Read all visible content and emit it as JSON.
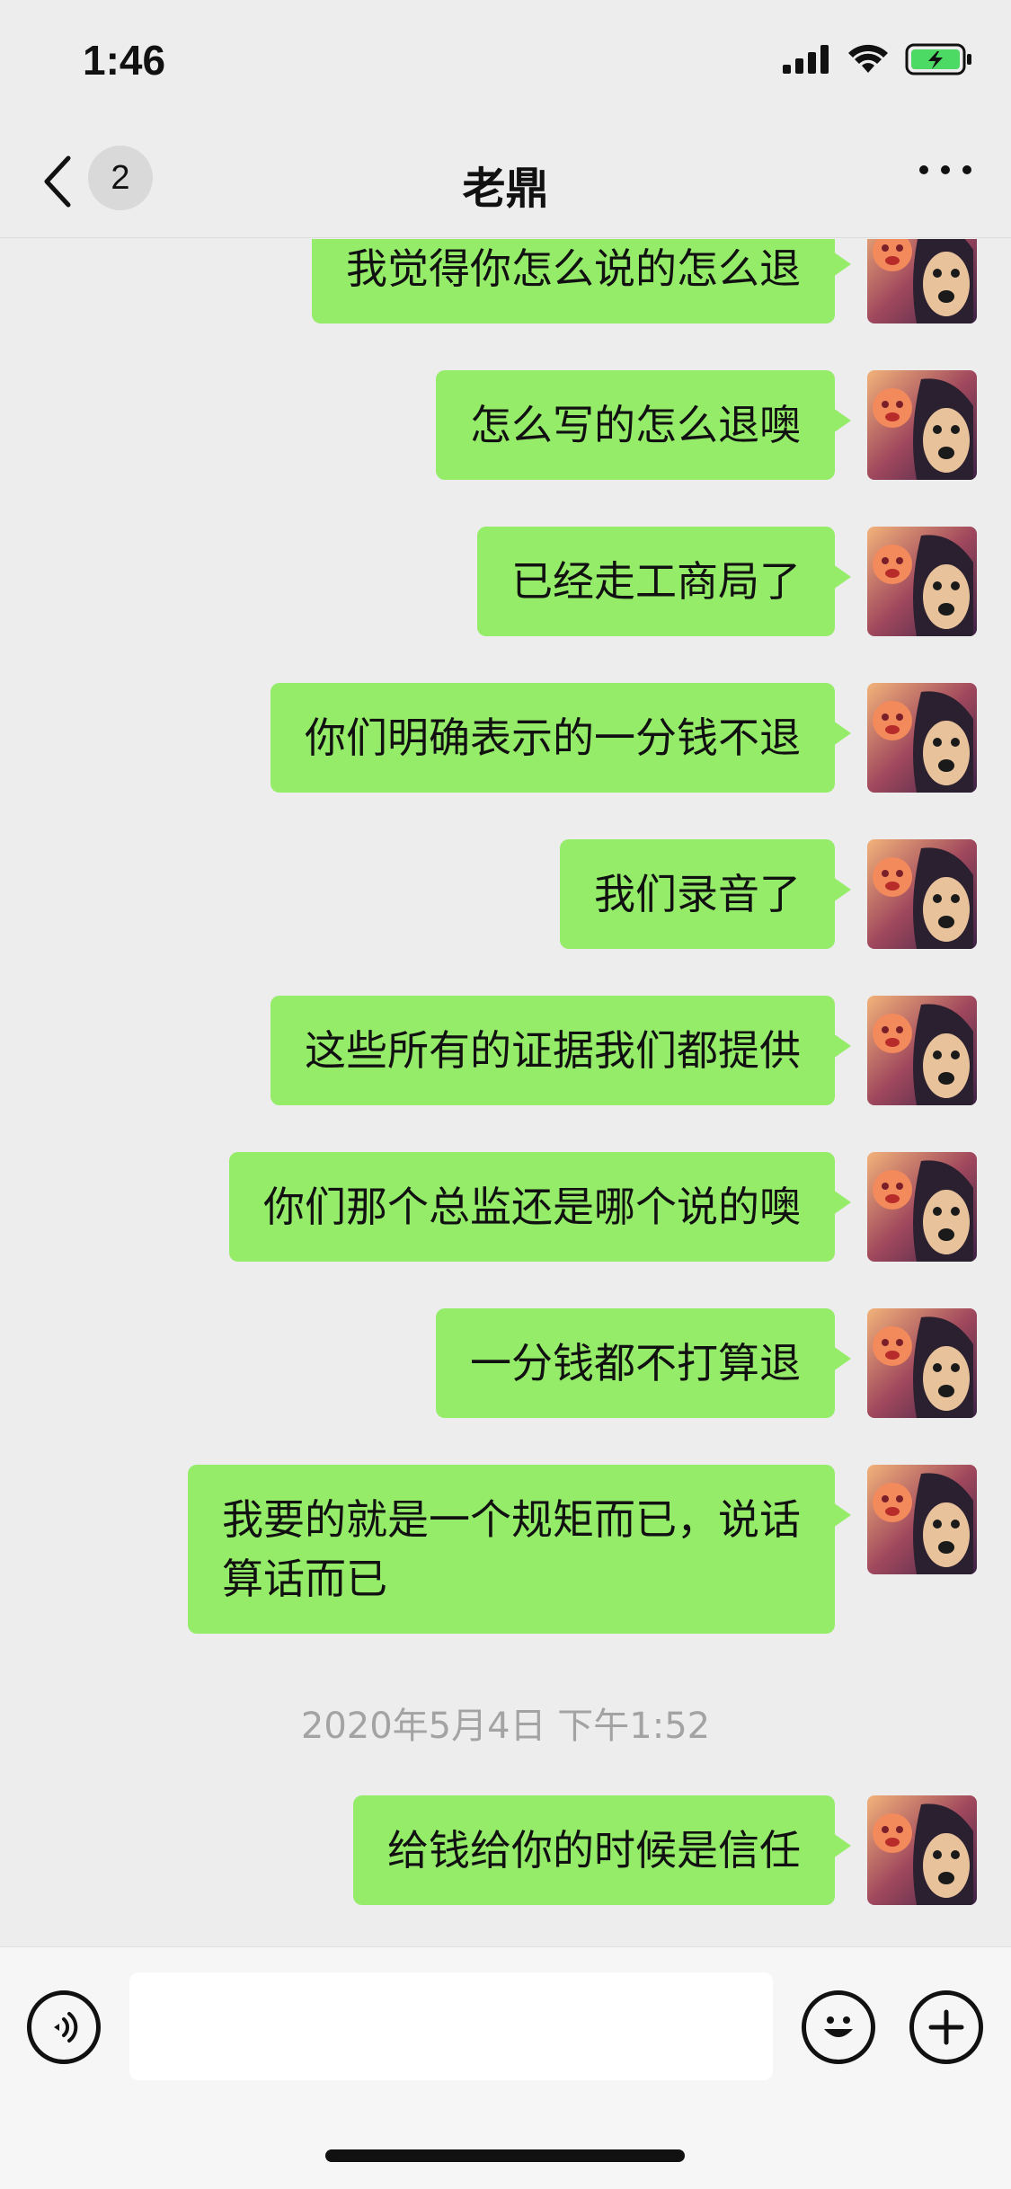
{
  "status_bar": {
    "time": "1:46"
  },
  "nav": {
    "title": "老鼎",
    "unread_count": "2"
  },
  "messages": [
    {
      "text": "我觉得你怎么说的怎么退"
    },
    {
      "text": "怎么写的怎么退噢"
    },
    {
      "text": "已经走工商局了"
    },
    {
      "text": "你们明确表示的一分钱不退"
    },
    {
      "text": "我们录音了"
    },
    {
      "text": "这些所有的证据我们都提供"
    },
    {
      "text": "你们那个总监还是哪个说的噢"
    },
    {
      "text": "一分钱都不打算退"
    },
    {
      "text": "我要的就是一个规矩而已，说话算话而已"
    },
    {
      "text": "给钱给你的时候是信任"
    }
  ],
  "timestamp": "2020年5月4日 下午1:52",
  "input": {
    "value": "",
    "placeholder": ""
  },
  "colors": {
    "bubble": "#95ec69",
    "background": "#ededed",
    "battery": "#4cd964"
  },
  "icons": [
    "back-chevron-icon",
    "more-dots-icon",
    "voice-icon",
    "emoji-icon",
    "plus-icon",
    "signal-icon",
    "wifi-icon",
    "battery-icon"
  ]
}
